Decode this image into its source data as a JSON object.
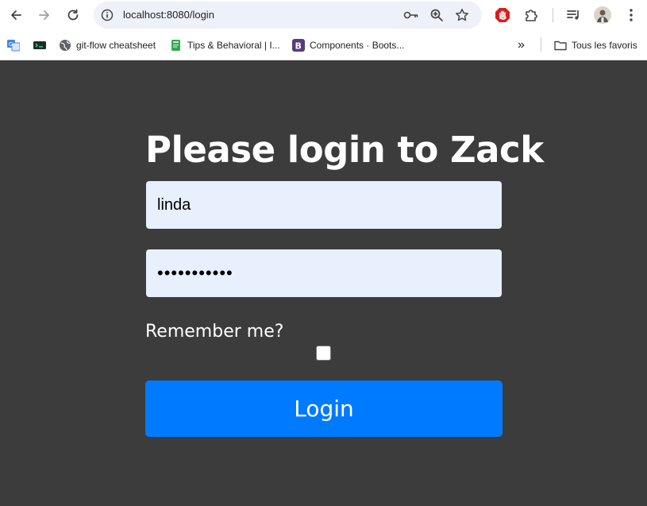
{
  "browser": {
    "url": "localhost:8080/login",
    "icons": {
      "back": "arrow-left-icon",
      "forward": "arrow-right-icon",
      "reload": "reload-icon",
      "site_info": "info-icon",
      "password": "key-icon",
      "zoom": "zoom-icon",
      "bookmark_star": "star-icon",
      "extension_adblock": "stop-hand-icon",
      "extensions": "puzzle-icon",
      "media": "playlist-icon",
      "profile": "avatar-icon",
      "menu": "kebab-icon"
    }
  },
  "bookmarks": {
    "items": [
      {
        "label": "",
        "icon": "translate-icon"
      },
      {
        "label": "",
        "icon": "terminal-icon"
      },
      {
        "label": "git-flow cheatsheet",
        "icon": "globe-icon"
      },
      {
        "label": "Tips & Behavioral | I...",
        "icon": "book-icon"
      },
      {
        "label": "Components · Boots...",
        "icon": "bootstrap-icon"
      }
    ],
    "overflow": "»",
    "all_bookmarks": "Tous les favoris"
  },
  "login": {
    "title": "Please login to Zack",
    "username_value": "linda",
    "password_mask": "•••••••••••",
    "remember_label": "Remember me?",
    "remember_checked": false,
    "button_label": "Login"
  },
  "colors": {
    "background": "#3c3c3c",
    "input_bg": "#e8f0fe",
    "button_bg": "#007bff"
  }
}
